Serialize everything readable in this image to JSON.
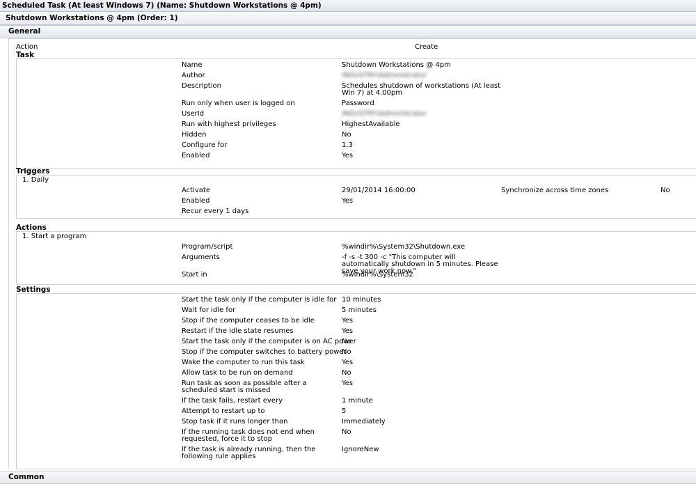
{
  "window_title": "Scheduled Task (At least Windows 7) (Name: Shutdown Workstations @ 4pm)",
  "item_title": "Shutdown Workstations @ 4pm (Order: 1)",
  "general": {
    "header": "General",
    "action_label": "Action",
    "action_value": "Create"
  },
  "task": {
    "header": "Task",
    "rows": [
      {
        "label": "Name",
        "value": "Shutdown Workstations @ 4pm"
      },
      {
        "label": "Author",
        "value": "INDUSTRY\\Administrator"
      },
      {
        "label": "Description",
        "value": "Schedules shutdown of workstations (At least Win 7) at 4.00pm"
      },
      {
        "label": "Run only when user is logged on",
        "value": "Password"
      },
      {
        "label": "UserId",
        "value": "INDUSTRY\\Administrator"
      },
      {
        "label": "Run with highest privileges",
        "value": "HighestAvailable"
      },
      {
        "label": "Hidden",
        "value": "No"
      },
      {
        "label": "Configure for",
        "value": "1.3"
      },
      {
        "label": "Enabled",
        "value": "Yes"
      }
    ]
  },
  "triggers": {
    "header": "Triggers",
    "item": "1. Daily",
    "rows": [
      {
        "label": "Activate",
        "value": "29/01/2014 16:00:00"
      },
      {
        "label": "Enabled",
        "value": "Yes"
      },
      {
        "label": "Recur every 1 days",
        "value": ""
      }
    ],
    "extra_label": "Synchronize across time zones",
    "extra_value": "No"
  },
  "actions": {
    "header": "Actions",
    "item": "1. Start a program",
    "rows": [
      {
        "label": "Program/script",
        "value": "%windir%\\System32\\Shutdown.exe"
      },
      {
        "label": "Arguments",
        "value": "-f -s -t 300 -c \"This computer will automatically shutdown in 5 minutes. Please save your work now.\""
      },
      {
        "label": "Start in",
        "value": "%windir%\\System32"
      }
    ]
  },
  "settings": {
    "header": "Settings",
    "rows": [
      {
        "label": "Start the task only if the computer is idle for",
        "value": "10 minutes"
      },
      {
        "label": "Wait for idle for",
        "value": "5 minutes"
      },
      {
        "label": "Stop if the computer ceases to be idle",
        "value": "Yes"
      },
      {
        "label": "Restart if the idle state resumes",
        "value": "Yes"
      },
      {
        "label": "Start the task only if the computer is on AC power",
        "value": "No"
      },
      {
        "label": "Stop if the computer switches to battery power",
        "value": "No"
      },
      {
        "label": "Wake the computer to run this task",
        "value": "Yes"
      },
      {
        "label": "Allow task to be run on demand",
        "value": "No"
      },
      {
        "label": "Run task as soon as possible after a scheduled start is missed",
        "value": "Yes"
      },
      {
        "label": "If the task fails, restart every",
        "value": "1 minute"
      },
      {
        "label": "Attempt to restart up to",
        "value": "5"
      },
      {
        "label": "Stop task if it runs longer than",
        "value": "Immediately"
      },
      {
        "label": "If the running task does not end when requested, force it to stop",
        "value": "No"
      },
      {
        "label": "If the task is already running, then the following rule applies",
        "value": "IgnoreNew"
      }
    ]
  },
  "common": {
    "header": "Common"
  }
}
